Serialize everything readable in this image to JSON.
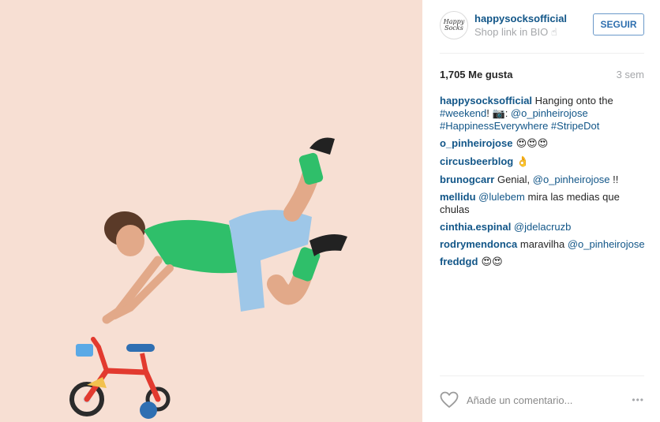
{
  "post": {
    "account": {
      "username": "happysocksofficial",
      "bio": "Shop link in BIO ☝",
      "avatar_text": "Happy Socks",
      "follow_label": "SEGUIR"
    },
    "likes": "1,705 Me gusta",
    "time_ago": "3 sem",
    "caption": {
      "user": "happysocksofficial",
      "text_1": " Hanging onto the ",
      "tag_weekend": "#weekend",
      "text_2": "! 📷: ",
      "mention": "@o_pinheirojose",
      "tag_happiness": "#HappinessEverywhere",
      "tag_stripedot": "#StripeDot"
    },
    "comments": [
      {
        "user": "o_pinheirojose",
        "text": " 😍😍😍"
      },
      {
        "user": "circusbeerblog",
        "text": " 👌"
      },
      {
        "user": "brunogcarr",
        "text_before": " Genial, ",
        "mention": "@o_pinheirojose",
        "text_after": " !!"
      },
      {
        "user": "mellidu",
        "mention": " @lulebem",
        "text": " mira las medias que chulas"
      },
      {
        "user": "cinthia.espinal",
        "mention": " @jdelacruzb"
      },
      {
        "user": "rodrymendonca",
        "text": " maravilha ",
        "mention": "@o_pinheirojose"
      },
      {
        "user": "freddgd",
        "text": " 😍😍"
      }
    ],
    "add_comment_placeholder": "Añade un comentario...",
    "more_label": "•••",
    "icons": {
      "heart": "heart-outline-icon",
      "more": "more-options-icon"
    },
    "colors": {
      "link": "#125688",
      "follow_border": "#6a98c9",
      "photo_bg": "#f7dfd3"
    }
  }
}
